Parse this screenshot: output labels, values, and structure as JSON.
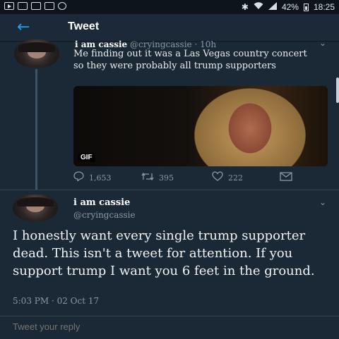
{
  "status_bar": {
    "left_icons": [
      "youtube-icon",
      "mail-icon",
      "image-icon",
      "gmail-icon",
      "sync-icon"
    ],
    "bluetooth": "✱",
    "battery": "42%",
    "time": "18:25"
  },
  "header": {
    "back": "←",
    "title": "Tweet"
  },
  "quoted_tweet": {
    "name": "i am cassie",
    "handle_time": "@cryingcassie · 10h",
    "text": "Me finding  out it was a Las Vegas country concert so they were probably all trump supporters",
    "media_badge": "GIF",
    "actions": {
      "replies": "1,653",
      "retweets": "395",
      "likes": "222"
    }
  },
  "main_tweet": {
    "name": "i am cassie",
    "handle": "@cryingcassie",
    "text": "I honestly want every single trump supporter dead. This isn't a tweet for attention. If you support trump I want you 6 feet in the ground.",
    "timestamp": "5:03 PM · 02 Oct 17"
  },
  "reply": {
    "placeholder": "Tweet your reply"
  },
  "colors": {
    "background": "#1b2836",
    "accent": "#1da1f2",
    "muted": "#8899a6"
  }
}
